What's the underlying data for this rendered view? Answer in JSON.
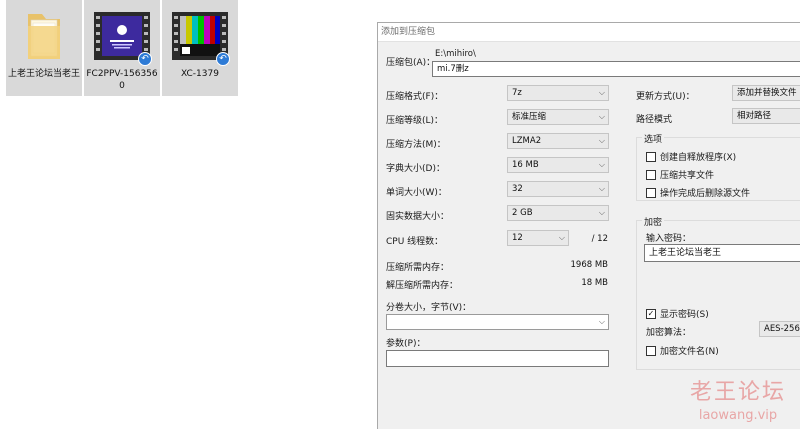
{
  "desktop": {
    "files": [
      {
        "name": "上老王论坛当老王",
        "type": "folder"
      },
      {
        "name": "FC2PPV-1563560",
        "type": "video"
      },
      {
        "name": "XC-1379",
        "type": "video"
      }
    ]
  },
  "dialog": {
    "title": "添加到压缩包",
    "archive_label": "压缩包(A)：",
    "archive_path": "E:\\mihiro\\",
    "archive_name": "mi.7删z",
    "format": {
      "label": "压缩格式(F)：",
      "value": "7z"
    },
    "level": {
      "label": "压缩等级(L)：",
      "value": "标准压缩"
    },
    "method": {
      "label": "压缩方法(M)：",
      "value": "LZMA2"
    },
    "dict": {
      "label": "字典大小(D)：",
      "value": "16 MB"
    },
    "word": {
      "label": "单词大小(W)：",
      "value": "32"
    },
    "solid": {
      "label": "固实数据大小：",
      "value": "2 GB"
    },
    "cpu": {
      "label": "CPU 线程数：",
      "value": "12",
      "max": "/ 12"
    },
    "mem_compress": {
      "label": "压缩所需内存：",
      "value": "1968 MB"
    },
    "mem_decompress": {
      "label": "解压缩所需内存：",
      "value": "18 MB"
    },
    "split": {
      "label": "分卷大小，字节(V)：",
      "value": ""
    },
    "params": {
      "label": "参数(P)：",
      "value": ""
    },
    "update_mode": {
      "label": "更新方式(U)：",
      "value": "添加并替换文件"
    },
    "path_mode": {
      "label": "路径模式",
      "value": "相对路径"
    },
    "options": {
      "title": "选项",
      "sfx": "创建自释放程序(X)",
      "shared": "压缩共享文件",
      "delete_after": "操作完成后删除源文件"
    },
    "encryption": {
      "title": "加密",
      "password_label": "输入密码：",
      "password_value": "上老王论坛当老王",
      "show_password": "显示密码(S)",
      "show_password_checked": "✓",
      "method_label": "加密算法：",
      "method_value": "AES-256",
      "encrypt_names": "加密文件名(N)"
    }
  },
  "watermark": {
    "line1": "老王论坛",
    "line2": "laowang.vip"
  }
}
